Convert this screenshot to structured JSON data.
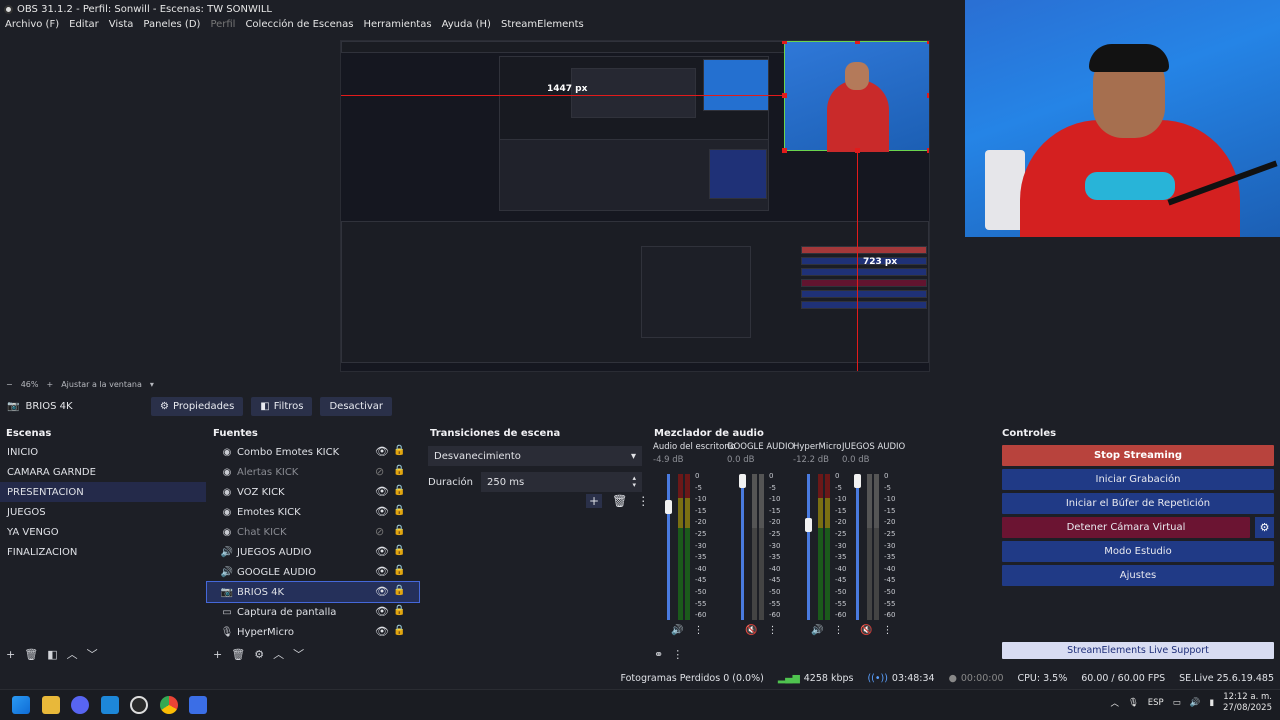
{
  "window": {
    "title": "OBS 31.1.2 - Perfil: Sonwill - Escenas: TW SONWILL"
  },
  "menu": [
    "Archivo (F)",
    "Editar",
    "Vista",
    "Paneles (D)",
    "Perfil",
    "Colección de Escenas",
    "Herramientas",
    "Ayuda (H)",
    "StreamElements"
  ],
  "preview": {
    "guide_label_h": "1447 px",
    "guide_label_v": "723 px",
    "zoom": "46%",
    "fit_label": "Ajustar a la ventana"
  },
  "source_toolbar": {
    "selected_source": "BRIOS 4K",
    "properties": "Propiedades",
    "filters": "Filtros",
    "deactivate": "Desactivar"
  },
  "scenes": {
    "title": "Escenas",
    "items": [
      "INICIO",
      "CAMARA GARNDE",
      "PRESENTACION",
      "JUEGOS",
      "YA VENGO",
      "FINALIZACION"
    ],
    "selected": "PRESENTACION"
  },
  "sources": {
    "title": "Fuentes",
    "items": [
      {
        "label": "Combo Emotes KICK",
        "icon": "browser-icon",
        "visible": true,
        "dim": false
      },
      {
        "label": "Alertas KICK",
        "icon": "browser-icon",
        "visible": false,
        "dim": true
      },
      {
        "label": "VOZ KICK",
        "icon": "browser-icon",
        "visible": true,
        "dim": false
      },
      {
        "label": "Emotes KICK",
        "icon": "browser-icon",
        "visible": true,
        "dim": false
      },
      {
        "label": "Chat KICK",
        "icon": "browser-icon",
        "visible": false,
        "dim": true
      },
      {
        "label": "JUEGOS AUDIO",
        "icon": "speaker-icon",
        "visible": true,
        "dim": false
      },
      {
        "label": "GOOGLE AUDIO",
        "icon": "speaker-icon",
        "visible": true,
        "dim": false
      },
      {
        "label": "BRIOS 4K",
        "icon": "camera-icon",
        "visible": true,
        "dim": false
      },
      {
        "label": "Captura de pantalla",
        "icon": "monitor-icon",
        "visible": true,
        "dim": false
      },
      {
        "label": "HyperMicro",
        "icon": "mic-icon",
        "visible": true,
        "dim": false
      }
    ]
  },
  "transitions": {
    "title": "Transiciones de escena",
    "type": "Desvanecimiento",
    "duration_label": "Duración",
    "duration_value": "250 ms"
  },
  "mixer": {
    "title": "Mezclador de audio",
    "channels": [
      {
        "name": "Audio del escritorio",
        "db": "-4.9 dB",
        "muted": false,
        "level": 0.82
      },
      {
        "name": "GOOGLE AUDIO",
        "db": "0.0 dB",
        "muted": true,
        "level": 1.0
      },
      {
        "name": "HyperMicro",
        "db": "-12.2 dB",
        "muted": false,
        "level": 0.7
      },
      {
        "name": "JUEGOS AUDIO",
        "db": "0.0 dB",
        "muted": true,
        "level": 1.0
      }
    ],
    "scale": [
      "0",
      "-5",
      "-10",
      "-15",
      "-20",
      "-25",
      "-30",
      "-35",
      "-40",
      "-45",
      "-50",
      "-55",
      "-60"
    ]
  },
  "controls": {
    "title": "Controles",
    "stop_streaming": "Stop Streaming",
    "start_recording": "Iniciar Grabación",
    "replay_buffer": "Iniciar el Búfer de Repetición",
    "stop_virtual_cam": "Detener Cámara Virtual",
    "studio_mode": "Modo Estudio",
    "settings": "Ajustes",
    "se_support": "StreamElements Live Support"
  },
  "status": {
    "dropped": "Fotogramas Perdidos 0 (0.0%)",
    "bitrate": "4258 kbps",
    "stream_time": "03:48:34",
    "rec_time": "00:00:00",
    "cpu": "CPU: 3.5%",
    "fps": "60.00 / 60.00 FPS",
    "se_version": "SE.Live 25.6.19.485"
  },
  "taskbar": {
    "lang": "ESP",
    "time": "12:12 a. m.",
    "date": "27/08/2025"
  },
  "colors": {
    "accent_red": "#b8433d",
    "accent_blue": "#203a86",
    "guide_red": "#e21b1b"
  }
}
